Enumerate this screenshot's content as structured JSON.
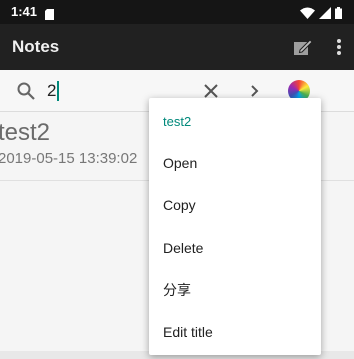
{
  "status_bar": {
    "time": "1:41",
    "icons": [
      "sd-card-icon",
      "wifi-icon",
      "signal-icon",
      "battery-icon"
    ]
  },
  "app_bar": {
    "title": "Notes",
    "icons": [
      "edit-note-icon",
      "more-vert-icon"
    ]
  },
  "search": {
    "query": "2",
    "icons": [
      "search-icon",
      "close-icon",
      "chevron-right-icon",
      "color-palette-icon"
    ]
  },
  "note": {
    "title": "test2",
    "date": "2019-05-15 13:39:02"
  },
  "context_menu": {
    "header": "test2",
    "items": [
      {
        "label": "Open"
      },
      {
        "label": "Copy"
      },
      {
        "label": "Delete"
      },
      {
        "label": "分享"
      },
      {
        "label": "Edit title"
      }
    ]
  },
  "colors": {
    "accent": "#00897b",
    "app_bar": "#212121",
    "status_bar": "#151515"
  }
}
